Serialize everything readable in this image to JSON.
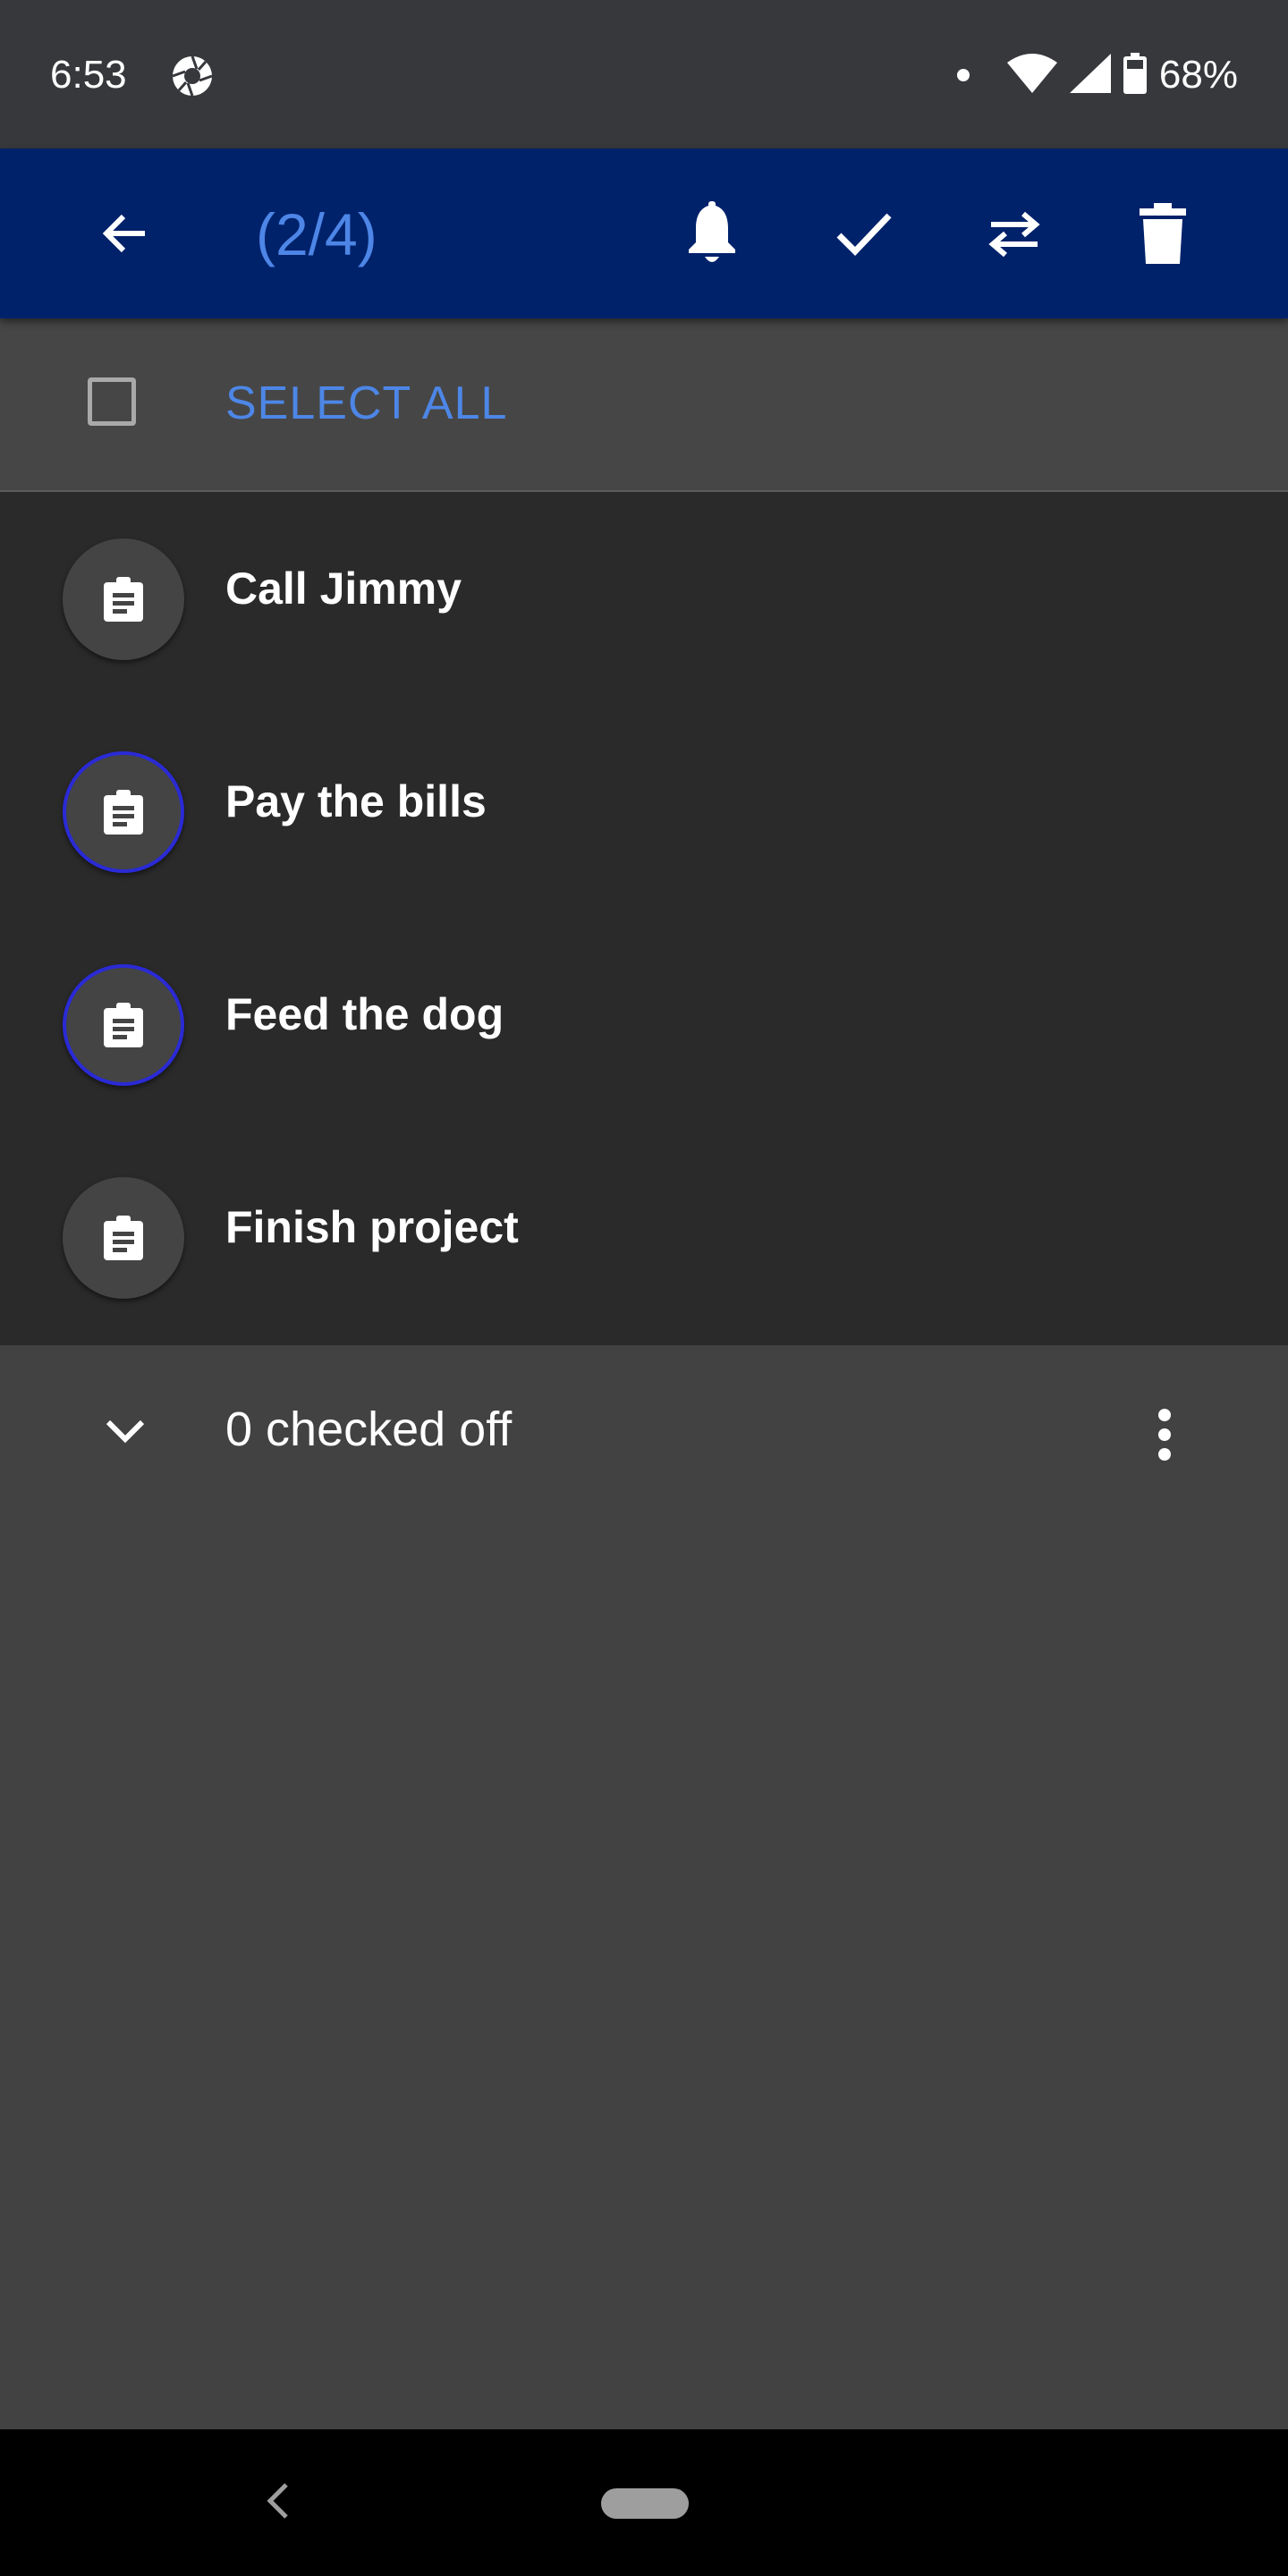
{
  "status_bar": {
    "time": "6:53",
    "battery": "68%",
    "icons": [
      "aperture-icon",
      "notification-dot-icon",
      "wifi-icon",
      "cell-signal-icon",
      "battery-icon"
    ]
  },
  "app_bar": {
    "title": "(2/4)",
    "actions": [
      "back-arrow-icon",
      "bell-icon",
      "check-icon",
      "swap-icon",
      "trash-icon"
    ]
  },
  "select_all": {
    "label": "SELECT ALL",
    "checked": false
  },
  "items": [
    {
      "label": "Call Jimmy",
      "selected": false
    },
    {
      "label": "Pay the bills",
      "selected": true
    },
    {
      "label": "Feed the dog",
      "selected": true
    },
    {
      "label": "Finish project",
      "selected": false
    }
  ],
  "checked_section": {
    "label": "0 checked off"
  },
  "colors": {
    "app_bar": "#00226b",
    "accent": "#4d86e6",
    "selected_ring": "#2a2ad6",
    "list_bg": "#2a2a2a",
    "page_bg": "#424242"
  }
}
